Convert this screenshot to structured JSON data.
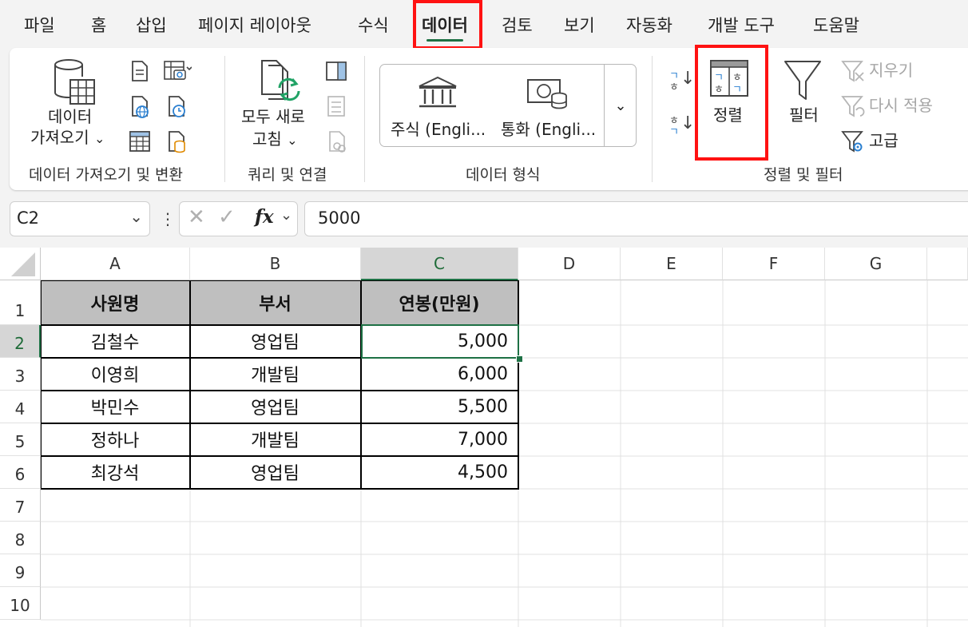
{
  "menu": {
    "tabs": [
      "파일",
      "홈",
      "삽입",
      "페이지 레이아웃",
      "수식",
      "데이터",
      "검토",
      "보기",
      "자동화",
      "개발 도구",
      "도움말"
    ],
    "active_tab": "데이터"
  },
  "ribbon": {
    "get_data": {
      "label_line1": "데이터",
      "label_line2": "가져오기",
      "group": "데이터 가져오기 및 변환"
    },
    "queries": {
      "refresh_line1": "모두 새로",
      "refresh_line2": "고침",
      "group": "쿼리 및 연결"
    },
    "data_types": {
      "stocks": "주식 (Engli...",
      "currencies": "통화 (Engli...",
      "group": "데이터 형식"
    },
    "sort_filter": {
      "sort_label": "정렬",
      "filter_label": "필터",
      "clear_label": "지우기",
      "reapply_label": "다시 적용",
      "advanced_label": "고급",
      "sort_asc_glyph_top": "ㄱ",
      "sort_asc_glyph_bottom": "ㅎ",
      "sort_desc_glyph_top": "ㅎ",
      "sort_desc_glyph_bottom": "ㄱ",
      "group": "정렬 및 필터"
    }
  },
  "formula_bar": {
    "name_box": "C2",
    "fx": "fx",
    "value": "5000"
  },
  "grid": {
    "columns": [
      "A",
      "B",
      "C",
      "D",
      "E",
      "F",
      "G"
    ],
    "selected_column": "C",
    "rows": [
      "1",
      "2",
      "3",
      "4",
      "5",
      "6",
      "7",
      "8",
      "9",
      "10"
    ],
    "selected_row": "2",
    "table": {
      "headers": [
        "사원명",
        "부서",
        "연봉(만원)"
      ],
      "data": [
        [
          "김철수",
          "영업팀",
          "5,000"
        ],
        [
          "이영희",
          "개발팀",
          "6,000"
        ],
        [
          "박민수",
          "영업팀",
          "5,500"
        ],
        [
          "정하나",
          "개발팀",
          "7,000"
        ],
        [
          "최강석",
          "영업팀",
          "4,500"
        ]
      ]
    }
  },
  "colors": {
    "accent": "#1e7145",
    "highlight": "#ff1212",
    "table_header": "#bfbfbf"
  }
}
